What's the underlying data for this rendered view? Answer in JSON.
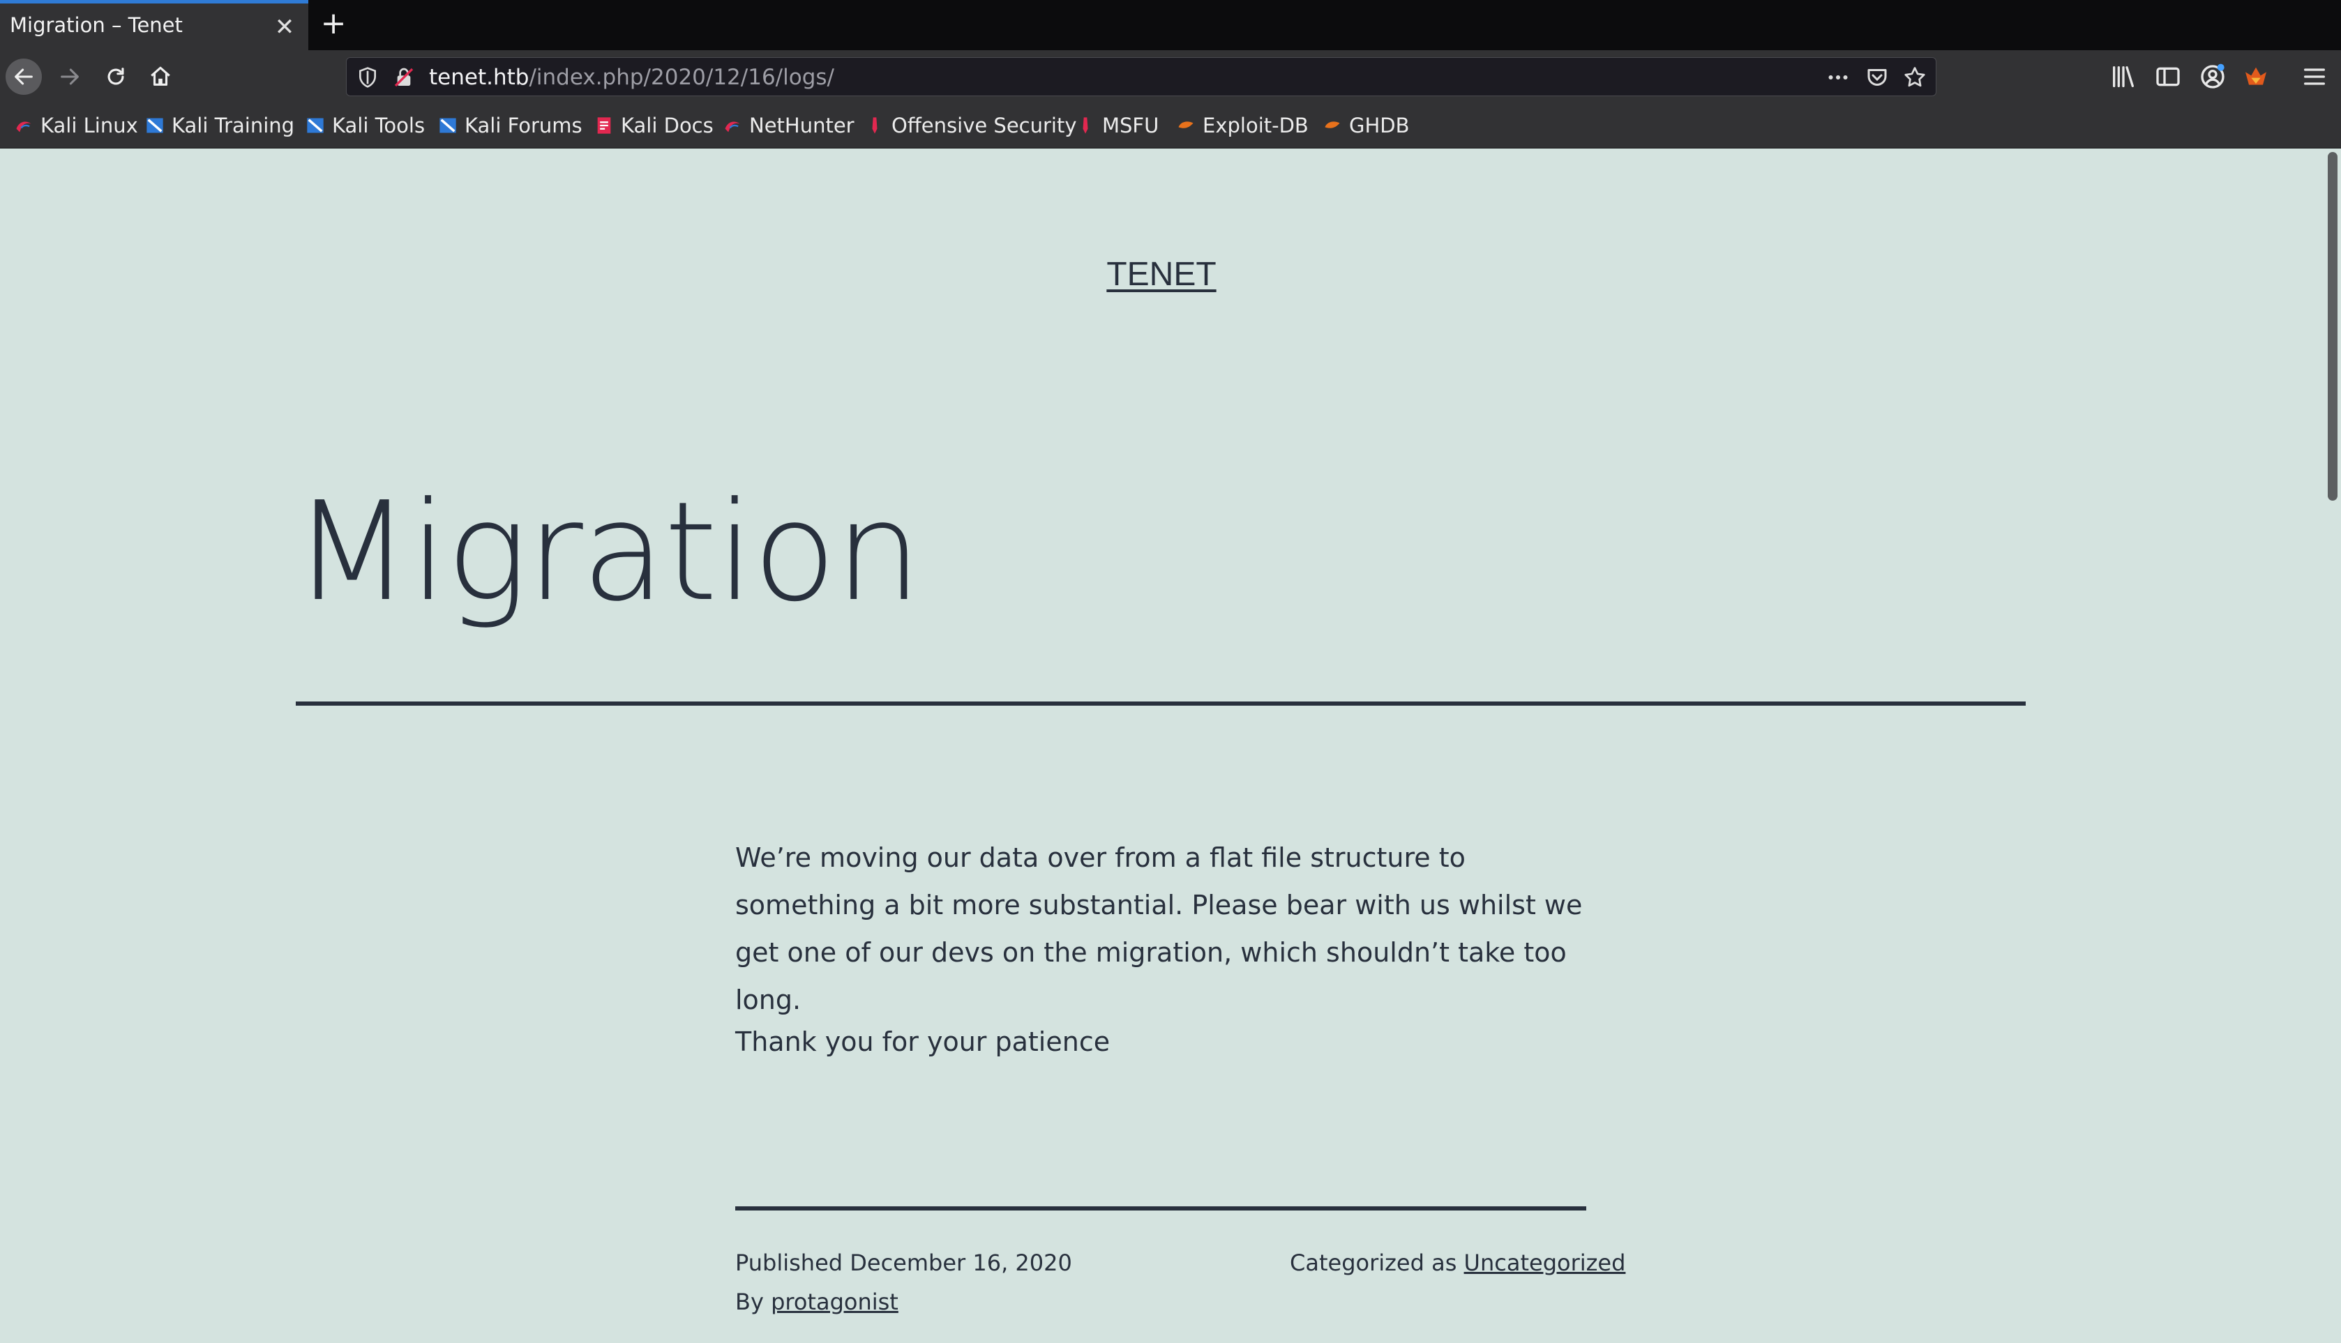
{
  "browser": {
    "tab_title": "Migration – Tenet",
    "tab_close_icon": "close-icon",
    "new_tab_icon": "plus-icon",
    "url_host": "tenet.htb",
    "url_path": "/index.php/2020/12/16/logs/",
    "accent_color": "#2f7bd6"
  },
  "bookmarks": [
    {
      "label": "Kali Linux",
      "icon": "kali-dragon-icon"
    },
    {
      "label": "Kali Training",
      "icon": "kali-training-icon"
    },
    {
      "label": "Kali Tools",
      "icon": "kali-tools-icon"
    },
    {
      "label": "Kali Forums",
      "icon": "kali-forums-icon"
    },
    {
      "label": "Kali Docs",
      "icon": "kali-docs-icon"
    },
    {
      "label": "NetHunter",
      "icon": "nethunter-icon"
    },
    {
      "label": "Offensive Security",
      "icon": "offsec-icon"
    },
    {
      "label": "MSFU",
      "icon": "msfu-icon"
    },
    {
      "label": "Exploit-DB",
      "icon": "exploitdb-icon"
    },
    {
      "label": "GHDB",
      "icon": "ghdb-icon"
    }
  ],
  "page": {
    "site_title": "TENET",
    "post_title": "Migration",
    "paragraphs": [
      "We’re moving our data over from a flat file structure to something a bit more substantial. Please bear with us whilst we get one of our devs on the migration, which shouldn’t take too long.",
      "Thank you for your patience"
    ],
    "published_label": "Published",
    "published_date": "December 16, 2020",
    "category_label": "Categorized as",
    "category": "Uncategorized",
    "author_label": "By",
    "author": "protagonist",
    "background_color": "#d4e3df",
    "text_color": "#28303d"
  }
}
